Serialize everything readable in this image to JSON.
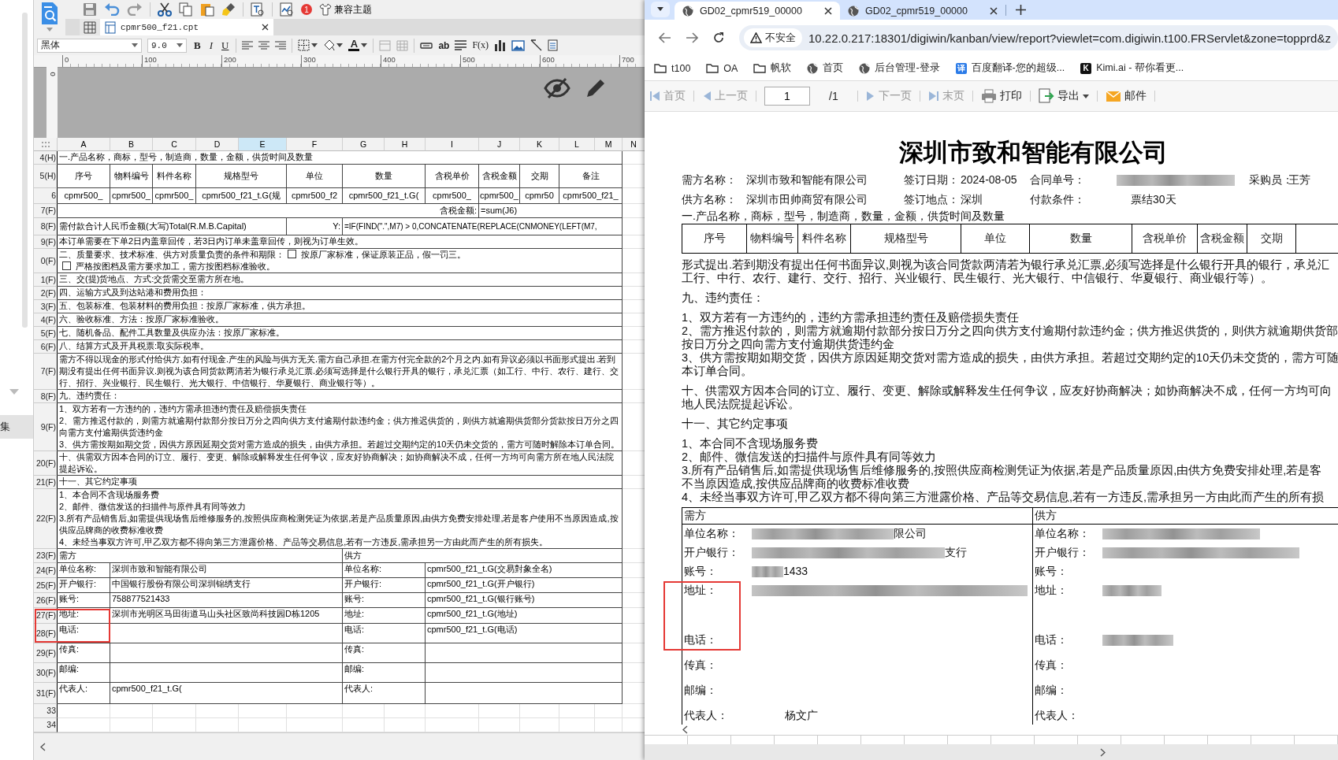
{
  "designer": {
    "toolbar": {
      "badge": "1",
      "theme_button": "兼容主题"
    },
    "file_tab": {
      "label": "cpmr500_f21.cpt"
    },
    "format_bar": {
      "font": "黑体",
      "size": "9.0",
      "style_buttons": [
        "B",
        "I",
        "U"
      ],
      "font_color": "A",
      "text_tool": "ab",
      "formula_tool": "F(x)"
    },
    "sidebar": {
      "item": "集"
    },
    "ruler": [
      "0",
      "100",
      "200",
      "300",
      "400",
      "500",
      "600",
      "700"
    ],
    "vertical_ruler": "0",
    "sheet": {
      "columns": [
        {
          "label": "A",
          "selected": false
        },
        {
          "label": "B",
          "selected": false
        },
        {
          "label": "C",
          "selected": false
        },
        {
          "label": "D",
          "selected": false
        },
        {
          "label": "E",
          "selected": true
        },
        {
          "label": "F",
          "selected": false
        },
        {
          "label": "G",
          "selected": false
        },
        {
          "label": "H",
          "selected": false
        },
        {
          "label": "I",
          "selected": false
        },
        {
          "label": "J",
          "selected": false
        },
        {
          "label": "K",
          "selected": false
        },
        {
          "label": "L",
          "selected": false
        },
        {
          "label": "M",
          "selected": false
        },
        {
          "label": "N",
          "selected": false
        }
      ],
      "rows": [
        {
          "header": "4(H)",
          "kind": "text",
          "text": "一.产品名称，商标，型号，制造商，数量，金额，供货时间及数量"
        },
        {
          "header": "5(H)",
          "kind": "columns",
          "cells": [
            "序号",
            "物料编号",
            "料件名称",
            "规格型号",
            "单位",
            "数量",
            "含税单价",
            "含税金额",
            "交期",
            "备注"
          ]
        },
        {
          "header": "6",
          "kind": "columns",
          "cells": [
            "cpmr500_",
            "cpmr500_",
            "cpmr500_",
            "cpmr500_f21_t.G(规",
            "cpmr500_f2",
            "cpmr500_f21_t.G(",
            "cpmr500_",
            "cpmr500_",
            "cpmr50",
            "cpmr500_f21_"
          ]
        },
        {
          "header": "7(F)",
          "kind": "total",
          "label": "含税金额:",
          "value": "=sum(J6)"
        },
        {
          "header": "8(F)",
          "kind": "formula",
          "label": "需付款合计人民币金额(大写)Total(R.M.B.Capital)",
          "symbol": "Y:",
          "value": "=IF(FIND(\".\",M7) > 0,CONCATENATE(REPLACE(CNMONEY(LEFT(M7,"
        },
        {
          "header": "9(F)",
          "kind": "text",
          "text": "本订单需要在下单2日内盖章回传，若3日内订单未盖章回传，则视为订单生效。"
        },
        {
          "header": "0(F)",
          "kind": "checks",
          "text": "二、质量要求、技术标准、供方对质量负责的条件和期限：",
          "options": [
            {
              "label": "按原厂家标准，保证原装正品，假一罚三。",
              "checked": false
            },
            {
              "label": "严格按图档及需方要求加工，需方按图档标准验收。",
              "checked": false
            }
          ]
        },
        {
          "header": "1(F)",
          "kind": "text",
          "text": "三、交(提)货地点、方式:交货需交至需方所在地。"
        },
        {
          "header": "2(F)",
          "kind": "text",
          "text": "四、运输方式及到达站港和费用负担："
        },
        {
          "header": "3(F)",
          "kind": "text",
          "text": "五、包装标准、包装材料的费用负担：按原厂家标准，供方承担。"
        },
        {
          "header": "4(F)",
          "kind": "text",
          "text": "六、验收标准、方法：按原厂家标准验收。"
        },
        {
          "header": "5(F)",
          "kind": "text",
          "text": "七、随机备品、配件工具数量及供应办法：按原厂家标准。"
        },
        {
          "header": "6(F)",
          "kind": "text",
          "text": "八、结算方式及开具税票:取实际税率。"
        },
        {
          "header": "7(F)",
          "kind": "text",
          "text": "需方不得以现金的形式付给供方.如有付现金.产生的风险与供方无关.需方自己承担.在需方付完全款的2个月之内.如有异议必须以书面形式提出.若到期没有提出任何书面异议.则视为该合同货款两清若为银行承兑汇票.必须写选择是什么银行开具的银行，承兑汇票（如工行、中行、农行、建行、交行、招行、兴业银行、民生银行、光大银行、中信银行、华夏银行、商业银行等）。"
        },
        {
          "header": "8(F)",
          "kind": "text",
          "text": "九、违约责任："
        },
        {
          "header": "9(F)",
          "kind": "lines",
          "lines": [
            "1、双方若有一方违约的，违约方需承担违约责任及赔偿损失责任",
            "2、需方推迟付款的，则需方就逾期付款部分按日万分之四向供方支付逾期付款违约金；供方推迟供货的，则供方就逾期供货部分货款按日万分之四向需方支付逾期供货违约金",
            "3、供方需按期如期交货，因供方原因延期交货对需方造成的损失，由供方承担。若超过交期约定的10天仍未交货的，需方可随时解除本订单合同。"
          ]
        },
        {
          "header": "20(F)",
          "kind": "text",
          "text": "十、供需双方因本合同的订立、履行、变更、解除或解释发生任何争议，应友好协商解决；如协商解决不成，任何一方均可向需方所在地人民法院提起诉讼。"
        },
        {
          "header": "21(F)",
          "kind": "text",
          "text": "十一、其它约定事项"
        },
        {
          "header": "22(F)",
          "kind": "lines",
          "lines": [
            "1、本合同不含现场服务费",
            "2、邮件、微信发送的扫描件与原件具有同等效力",
            "3.所有产品销售后,如需提供现场售后维修服务的,按照供应商检测凭证为依据,若是产品质量原因,由供方免费安排处理,若是客户使用不当原因造成,按供应品牌商的收费标准收费",
            "4、未经当事双方许可,甲乙双方都不得向第三方泄露价格、产品等交易信息,若有一方违反,需承担另一方由此而产生的所有损失。"
          ]
        },
        {
          "header": "23(F)",
          "kind": "party-header",
          "left": "需方",
          "right": "供方"
        },
        {
          "header": "24(F)",
          "kind": "party",
          "left_label": "单位名称:",
          "left_value": "深圳市致和智能有限公司",
          "right_label": "单位名称:",
          "right_value": "cpmr500_f21_t.G(交易對象全名)"
        },
        {
          "header": "25(F)",
          "kind": "party",
          "left_label": "开户银行:",
          "left_value": "中国银行股份有限公司深圳锦绣支行",
          "right_label": "开户银行:",
          "right_value": "cpmr500_f21_t.G(开户银行)"
        },
        {
          "header": "26(F)",
          "kind": "party",
          "left_label": "账号:",
          "left_value": "758877521433",
          "right_label": "账号:",
          "right_value": "cpmr500_f21_t.G(银行账号)"
        },
        {
          "header": "27(F)",
          "kind": "party",
          "left_label": "地址:",
          "left_value": "深圳市光明区马田街道马山头社区致尚科技园D栋1205",
          "right_label": "地址:",
          "right_value": "cpmr500_f21_t.G(地址)"
        },
        {
          "header": "28(F)",
          "kind": "party",
          "left_label": "电话:",
          "right_label": "电话:",
          "right_value": "cpmr500_f21_t.G(电话)"
        },
        {
          "header": "29(F)",
          "kind": "party",
          "left_label": "传真:",
          "right_label": "传真:"
        },
        {
          "header": "30(F)",
          "kind": "party",
          "left_label": "邮编:",
          "right_label": "邮编:"
        },
        {
          "header": "31(F)",
          "kind": "party",
          "left_label": "代表人:",
          "left_value": "cpmr500_f21_t.G(",
          "right_label": "代表人:"
        },
        {
          "header": "33",
          "kind": "blank"
        },
        {
          "header": "34",
          "kind": "blank"
        }
      ]
    }
  },
  "browser": {
    "tabs": [
      {
        "title": "GD02_cpmr519_00000",
        "selected": true
      },
      {
        "title": "GD02_cpmr519_00000",
        "selected": false
      }
    ],
    "security": "不安全",
    "url": "10.22.0.217:18301/digiwin/kanban/view/report?viewlet=com.digiwin.t100.FRServlet&zone=topprd&z",
    "bookmarks": [
      {
        "label": "t100",
        "kind": "folder"
      },
      {
        "label": "OA",
        "kind": "folder"
      },
      {
        "label": "帆软",
        "kind": "folder"
      },
      {
        "label": "首页",
        "kind": "globe"
      },
      {
        "label": "后台管理-登录",
        "kind": "globe"
      },
      {
        "label": "百度翻译-您的超级...",
        "kind": "badge",
        "icon_text": "译",
        "color": "#2b7be8"
      },
      {
        "label": "Kimi.ai - 帮你看更...",
        "kind": "badge",
        "icon_text": "K",
        "color": "#111111"
      }
    ],
    "report_toolbar": {
      "page": "1",
      "total": "/1",
      "buttons": [
        {
          "label": "首页",
          "kind": "first",
          "disabled": true
        },
        {
          "label": "上一页",
          "kind": "prev",
          "disabled": true
        },
        {
          "label": "下一页",
          "kind": "next",
          "disabled": true
        },
        {
          "label": "末页",
          "kind": "last",
          "disabled": true
        },
        {
          "label": "打印",
          "kind": "print",
          "disabled": false
        },
        {
          "label": "导出",
          "kind": "export",
          "disabled": false
        },
        {
          "label": "邮件",
          "kind": "mail",
          "disabled": false
        }
      ]
    },
    "report": {
      "title": "深圳市致和智能有限公司",
      "info": [
        [
          {
            "label": "需方名称：",
            "value": "深圳市致和智能有限公司"
          },
          {
            "label": "签订日期：",
            "value": "2024-08-05"
          },
          {
            "label": "合同单号：",
            "redacted": true
          },
          {
            "label": "采购员：",
            "value": "王芳"
          }
        ],
        [
          {
            "label": "供方名称：",
            "value": "深圳市田帅商贸有限公司"
          },
          {
            "label": "签订地点：",
            "value": "深圳"
          },
          {
            "label": "付款条件：",
            "value": "票结30天"
          }
        ]
      ],
      "section": "一.产品名称，商标，型号，制造商，数量，金额，供货时间及数量",
      "columns": [
        "序号",
        "物料编号",
        "料件名称",
        "规格型号",
        "单位",
        "数量",
        "含税单价",
        "含税金额",
        "交期"
      ],
      "blocks": [
        [
          "形式提出.若到期没有提出任何书面异议,则视为该合同货款两清若为银行承兑汇票,必须写选择是什么银行开具的银行，承兑汇",
          "工行、中行、农行、建行、交行、招行、兴业银行、民生银行、光大银行、中信银行、华夏银行、商业银行等）。"
        ],
        [
          "九、违约责任："
        ],
        [
          "1、双方若有一方违约的，违约方需承担违约责任及赔偿损失责任",
          "2、需方推迟付款的，则需方就逾期付款部分按日万分之四向供方支付逾期付款违约金；供方推迟供货的，则供方就逾期供货部",
          "按日万分之四向需方支付逾期供货违约金",
          "3、供方需按期如期交货，因供方原因延期交货对需方造成的损失，由供方承担。若超过交期约定的10天仍未交货的，需方可随",
          "本订单合同。"
        ],
        [
          "十、供需双方因本合同的订立、履行、变更、解除或解释发生任何争议，应友好协商解决；如协商解决不成，任何一方均可向",
          "地人民法院提起诉讼。"
        ],
        [
          "十一、其它约定事项"
        ],
        [
          "1、本合同不含现场服务费",
          "2、邮件、微信发送的扫描件与原件具有同等效力",
          "3.所有产品销售后,如需提供现场售后维修服务的,按照供应商检测凭证为依据,若是产品质量原因,由供方免费安排处理,若是客",
          "不当原因造成,按供应品牌商的收费标准收费",
          "4、未经当事双方许可,甲乙双方都不得向第三方泄露价格、产品等交易信息,若有一方违反,需承担另一方由此而产生的所有损"
        ]
      ],
      "parties": {
        "left": "需方",
        "right": "供方",
        "rows": [
          {
            "left_label": "单位名称：",
            "left_redacted": true,
            "left_value": "限公司",
            "right_label": "单位名称：",
            "right_redacted": true
          },
          {
            "left_label": "开户银行：",
            "left_redacted": true,
            "left_value": "支行",
            "right_label": "开户银行：",
            "right_redacted": true
          },
          {
            "left_label": "账号：",
            "left_redacted": true,
            "left_value": "1433",
            "right_label": "账号："
          },
          {
            "left_label": "地址：",
            "left_redacted": true,
            "right_label": "地址：",
            "right_redacted": true
          },
          {
            "left_label": "电话：",
            "right_label": "电话：",
            "right_redacted": true
          },
          {
            "left_label": "传真：",
            "right_label": "传真："
          },
          {
            "left_label": "邮编：",
            "right_label": "邮编："
          },
          {
            "left_label": "代表人：",
            "left_value": "杨文广",
            "right_label": "代表人："
          }
        ]
      }
    }
  }
}
